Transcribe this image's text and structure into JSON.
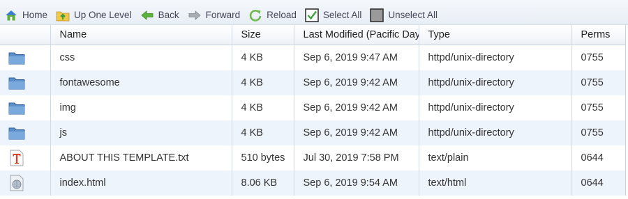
{
  "toolbar": {
    "home": "Home",
    "up": "Up One Level",
    "back": "Back",
    "forward": "Forward",
    "reload": "Reload",
    "select_all": "Select All",
    "unselect_all": "Unselect All"
  },
  "columns": {
    "name": "Name",
    "size": "Size",
    "modified": "Last Modified (Pacific Daylight Time)",
    "type": "Type",
    "perms": "Perms"
  },
  "files": [
    {
      "icon": "folder-icon",
      "name": "css",
      "size": "4 KB",
      "modified": "Sep 6, 2019 9:47 AM",
      "type": "httpd/unix-directory",
      "perms": "0755"
    },
    {
      "icon": "folder-icon",
      "name": "fontawesome",
      "size": "4 KB",
      "modified": "Sep 6, 2019 9:42 AM",
      "type": "httpd/unix-directory",
      "perms": "0755"
    },
    {
      "icon": "folder-icon",
      "name": "img",
      "size": "4 KB",
      "modified": "Sep 6, 2019 9:42 AM",
      "type": "httpd/unix-directory",
      "perms": "0755"
    },
    {
      "icon": "folder-icon",
      "name": "js",
      "size": "4 KB",
      "modified": "Sep 6, 2019 9:42 AM",
      "type": "httpd/unix-directory",
      "perms": "0755"
    },
    {
      "icon": "text-file-icon",
      "name": "ABOUT THIS TEMPLATE.txt",
      "size": "510 bytes",
      "modified": "Jul 30, 2019 7:58 PM",
      "type": "text/plain",
      "perms": "0644"
    },
    {
      "icon": "html-file-icon",
      "name": "index.html",
      "size": "8.06 KB",
      "modified": "Sep 6, 2019 9:54 AM",
      "type": "text/html",
      "perms": "0644"
    }
  ]
}
